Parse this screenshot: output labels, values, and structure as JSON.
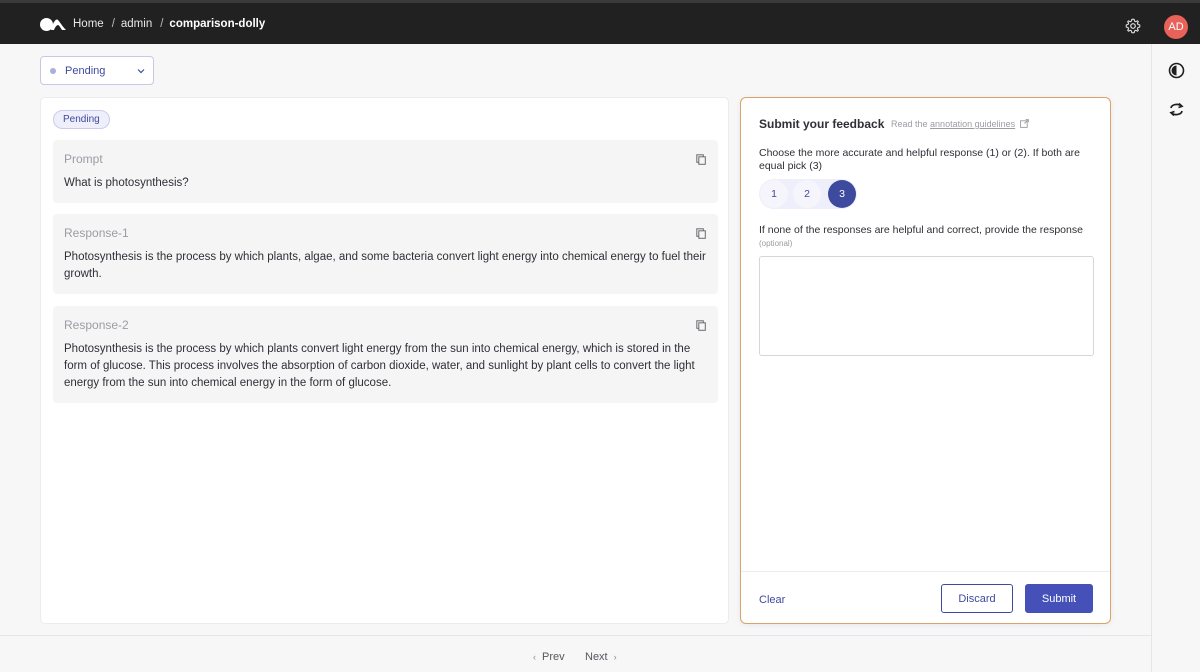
{
  "breadcrumb": {
    "home": "Home",
    "user": "admin",
    "dataset": "comparison-dolly"
  },
  "user": {
    "initials": "AD",
    "avatar_color": "#e8625a"
  },
  "status_filter": {
    "value": "Pending"
  },
  "record": {
    "status_badge": "Pending",
    "fields": [
      {
        "label": "Prompt",
        "text": "What is photosynthesis?"
      },
      {
        "label": "Response-1",
        "text": "Photosynthesis is the process by which plants, algae, and some bacteria convert light energy into chemical energy to fuel their growth."
      },
      {
        "label": "Response-2",
        "text": "Photosynthesis is the process by which plants convert light energy from the sun into chemical energy, which is stored in the form of glucose. This process involves the absorption of carbon dioxide, water, and sunlight by plant cells to convert the light energy from the sun into chemical energy in the form of glucose."
      }
    ]
  },
  "feedback": {
    "title": "Submit your feedback",
    "guidelines_prefix": "Read the",
    "guidelines_link": "annotation guidelines",
    "question1": "Choose the more accurate and helpful response (1) or (2). If both are equal pick (3)",
    "options": [
      "1",
      "2",
      "3"
    ],
    "selected": "3",
    "question2": "If none of the responses are helpful and correct, provide the response",
    "question2_optional": "(optional)",
    "answer_text": "",
    "clear_label": "Clear",
    "discard_label": "Discard",
    "submit_label": "Submit"
  },
  "pagination": {
    "prev": "Prev",
    "next": "Next"
  },
  "colors": {
    "accent": "#3e4a9e",
    "submit": "#4551b8",
    "focus_border": "#d9a36a",
    "topbar": "#212121"
  }
}
